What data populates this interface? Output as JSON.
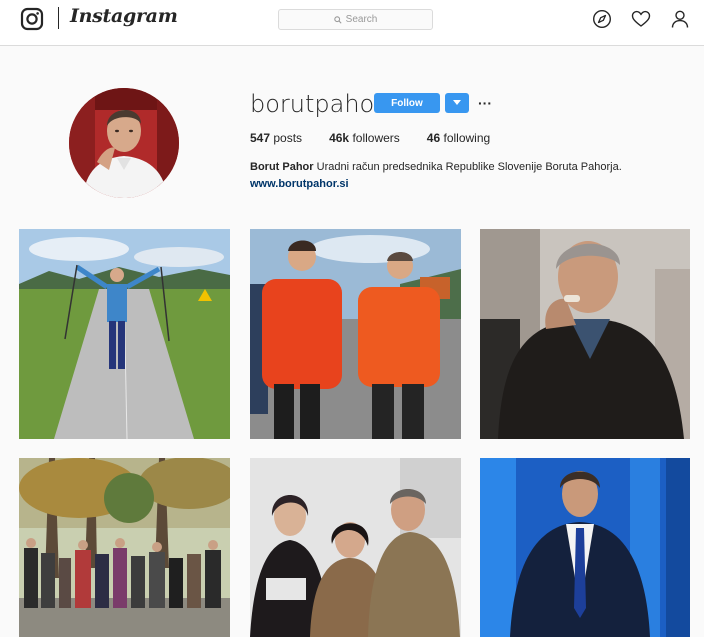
{
  "header": {
    "wordmark": "Instagram",
    "search_placeholder": "Search",
    "icons": [
      "instagram-logo-icon",
      "explore-compass-icon",
      "activity-heart-icon",
      "profile-user-icon"
    ]
  },
  "profile": {
    "username": "borutpahor",
    "follow_label": "Follow",
    "more_label": "···",
    "stats": {
      "posts_count": "547",
      "posts_label": "posts",
      "followers_count": "46k",
      "followers_label": "followers",
      "following_count": "46",
      "following_label": "following"
    },
    "full_name": "Borut Pahor",
    "bio_text": "Uradni račun predsednika Republike Slovenije Boruta Pahorja.",
    "website": "www.borutpahor.si"
  },
  "posts": [
    {
      "id": "post-1",
      "alt": "Man with hiking poles raising arms on a country road"
    },
    {
      "id": "post-2",
      "alt": "Two men in orange jackets walking"
    },
    {
      "id": "post-3",
      "alt": "Man in leather jacket close-up"
    },
    {
      "id": "post-4",
      "alt": "Crowd walking in autumn park"
    },
    {
      "id": "post-5",
      "alt": "Three people posing together"
    },
    {
      "id": "post-6",
      "alt": "Man in suit on blue background"
    }
  ],
  "colors": {
    "accent": "#3897f0",
    "link": "#003569",
    "text": "#262626",
    "border": "#dbdbdb"
  }
}
